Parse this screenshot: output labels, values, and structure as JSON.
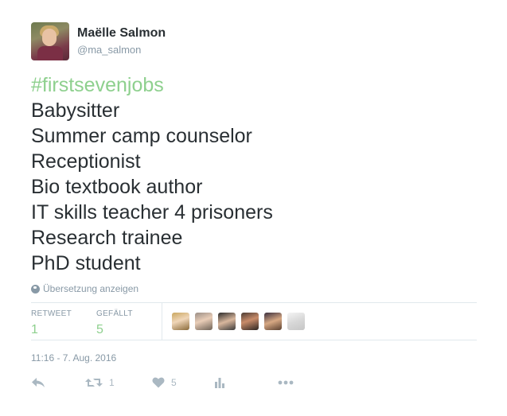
{
  "user": {
    "name": "Maëlle Salmon",
    "handle": "@ma_salmon"
  },
  "tweet": {
    "hashtag": "#firstsevenjobs",
    "lines": [
      "Babysitter",
      "Summer camp counselor",
      "Receptionist",
      "Bio textbook author",
      "IT skills teacher 4 prisoners",
      "Research trainee",
      "PhD student"
    ]
  },
  "translate_label": "Übersetzung anzeigen",
  "stats": {
    "retweet_label": "RETWEET",
    "retweet_count": "1",
    "likes_label": "GEFÄLLT",
    "likes_count": "5"
  },
  "timestamp": "11:16 - 7. Aug. 2016",
  "actions": {
    "retweet_count": "1",
    "like_count": "5"
  },
  "colors": {
    "accent": "#8ed08e",
    "muted": "#8899a6",
    "text": "#292f33",
    "divider": "#e1e8ed"
  }
}
